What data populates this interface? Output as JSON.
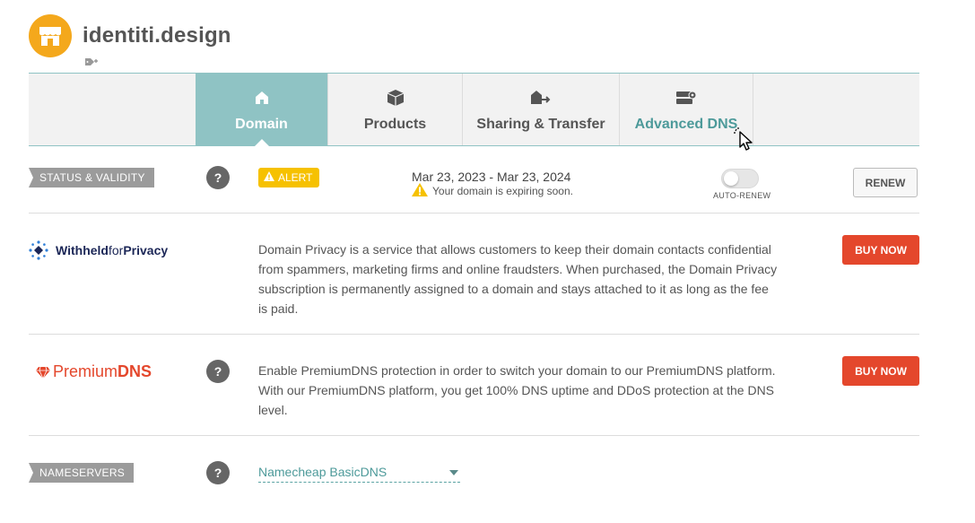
{
  "header": {
    "domain_name": "identiti.design",
    "avatar_icon": "store-icon",
    "tag_icon": "tag-add-icon",
    "avatar_color": "#f4a81c"
  },
  "tabs": [
    {
      "label": "Domain",
      "icon": "home-icon",
      "active": true
    },
    {
      "label": "Products",
      "icon": "box-icon",
      "active": false
    },
    {
      "label": "Sharing & Transfer",
      "icon": "transfer-icon",
      "active": false
    },
    {
      "label": "Advanced DNS",
      "icon": "server-icon",
      "active": false
    }
  ],
  "status": {
    "section_label": "STATUS & VALIDITY",
    "alert_label": "ALERT",
    "dates": "Mar 23, 2023 - Mar 23, 2024",
    "expire_note": "Your domain is expiring soon.",
    "auto_renew_label": "AUTO-RENEW",
    "auto_renew_on": false,
    "renew_label": "RENEW"
  },
  "privacy": {
    "logo_bold": "Withheld",
    "logo_light": "for",
    "logo_bold2": "Privacy",
    "description": "Domain Privacy is a service that allows customers to keep their domain contacts confidential from spammers, marketing firms and online fraudsters. When purchased, the Domain Privacy subscription is permanently assigned to a domain and stays attached to it as long as the fee is paid.",
    "buy_label": "BUY NOW"
  },
  "premium_dns": {
    "logo_light": "Premium",
    "logo_bold": "DNS",
    "description": "Enable PremiumDNS protection in order to switch your domain to our PremiumDNS platform. With our PremiumDNS platform, you get 100% DNS uptime and DDoS protection at the DNS level.",
    "buy_label": "BUY NOW"
  },
  "nameservers": {
    "section_label": "NAMESERVERS",
    "selected": "Namecheap BasicDNS"
  },
  "colors": {
    "accent_teal": "#8fc3c4",
    "buy_red": "#e4472c",
    "alert_yellow": "#f6c100"
  }
}
